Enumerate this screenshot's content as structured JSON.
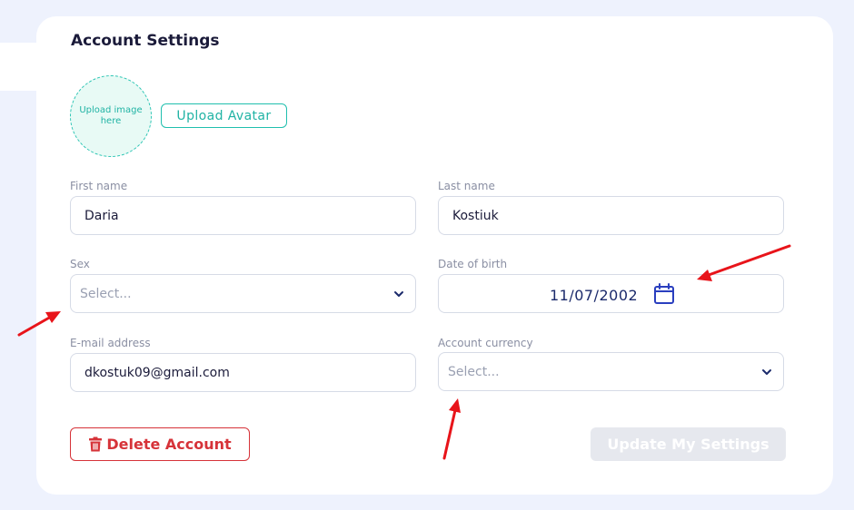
{
  "form": {
    "title": "Account Settings",
    "avatar": {
      "placeholder": "Upload image here",
      "upload_label": "Upload Avatar"
    },
    "first_name": {
      "label": "First name",
      "value": "Daria"
    },
    "last_name": {
      "label": "Last name",
      "value": "Kostiuk"
    },
    "sex": {
      "label": "Sex",
      "placeholder": "Select..."
    },
    "date_of_birth": {
      "label": "Date of birth",
      "value": "11/07/2002"
    },
    "email": {
      "label": "E-mail address",
      "value": "dkostuk09@gmail.com"
    },
    "currency": {
      "label": "Account currency",
      "placeholder": "Select..."
    },
    "delete_label": "Delete Account",
    "update_label": "Update My Settings"
  },
  "icons": {
    "trash": "trash-icon",
    "calendar": "calendar-icon",
    "chevron": "chevron-down-icon"
  },
  "colors": {
    "page_bg": "#eef2fd",
    "accent_teal": "#20b3a4",
    "danger": "#d63339",
    "annotation_arrow": "#e8141a"
  }
}
